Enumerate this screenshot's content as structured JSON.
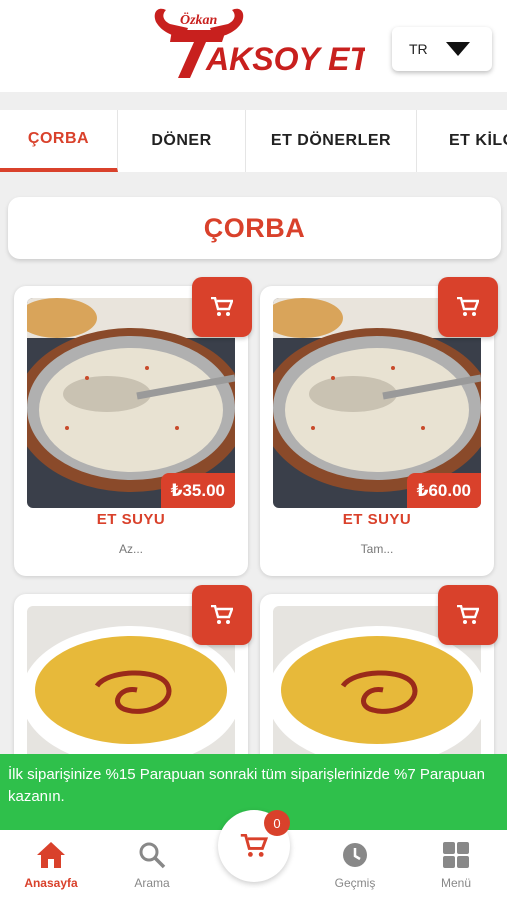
{
  "header": {
    "logo_top": "Özkan",
    "logo_main": "AKSOY ET",
    "language": "TR"
  },
  "tabs": [
    {
      "label": "ÇORBA"
    },
    {
      "label": "DÖNER"
    },
    {
      "label": "ET DÖNERLER"
    },
    {
      "label": "ET KİLO"
    }
  ],
  "section": {
    "title": "ÇORBA"
  },
  "products": [
    {
      "name": "ET SUYU",
      "price": "₺35.00",
      "desc": "Az..."
    },
    {
      "name": "ET SUYU",
      "price": "₺60.00",
      "desc": "Tam..."
    },
    {
      "name": "",
      "price": "",
      "desc": ""
    },
    {
      "name": "",
      "price": "",
      "desc": ""
    }
  ],
  "promo": {
    "text": "İlk siparişinize %15 Parapuan sonraki tüm siparişlerinizde %7 Parapuan kazanın."
  },
  "cart": {
    "count": "0"
  },
  "nav": {
    "home": "Anasayfa",
    "search": "Arama",
    "history": "Geçmiş",
    "menu": "Menü"
  },
  "colors": {
    "accent": "#d9412b",
    "promo": "#2fc04b"
  },
  "icons": [
    "cart-icon",
    "home-icon",
    "search-icon",
    "clock-icon",
    "grid-icon",
    "chevron-down-icon"
  ]
}
